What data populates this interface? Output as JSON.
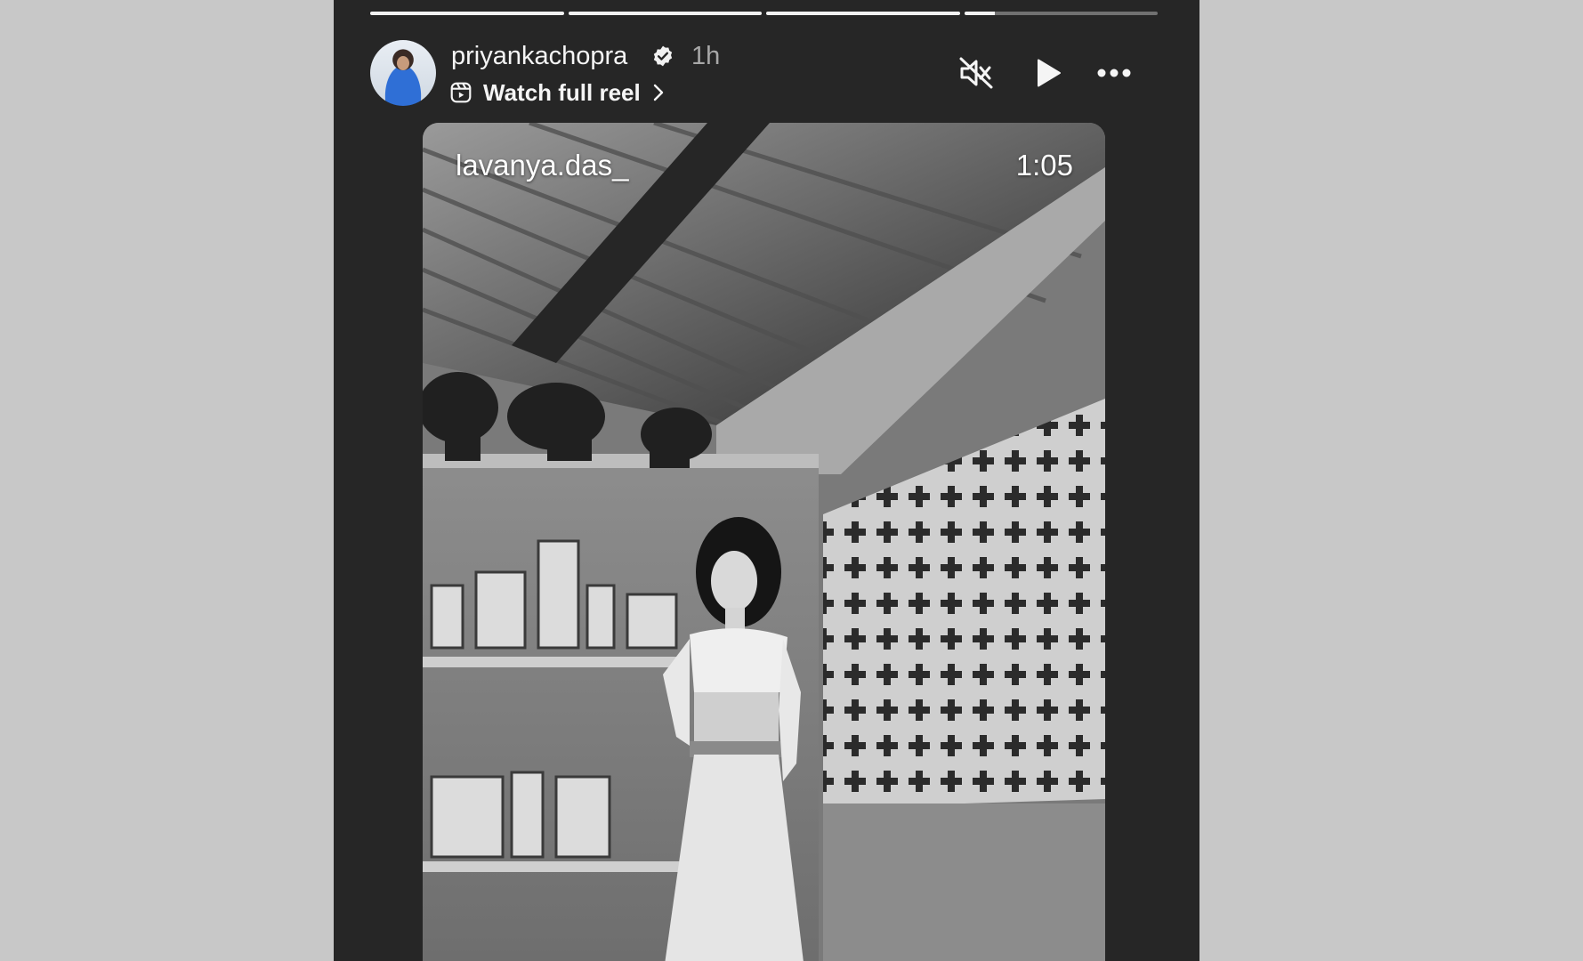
{
  "story": {
    "progress": [
      1,
      1,
      1,
      0.16
    ],
    "username": "priyankachopra",
    "verified": true,
    "time_ago": "1h",
    "reel_link": "Watch full reel",
    "icons": {
      "reel": "reel-icon",
      "chevron": "chevron-right-icon",
      "mute": "speaker-muted-icon",
      "play": "play-icon",
      "more": "more-horizontal-icon",
      "verified": "verified-badge-icon"
    }
  },
  "reel": {
    "username": "lavanya.das_",
    "duration": "1:05"
  }
}
